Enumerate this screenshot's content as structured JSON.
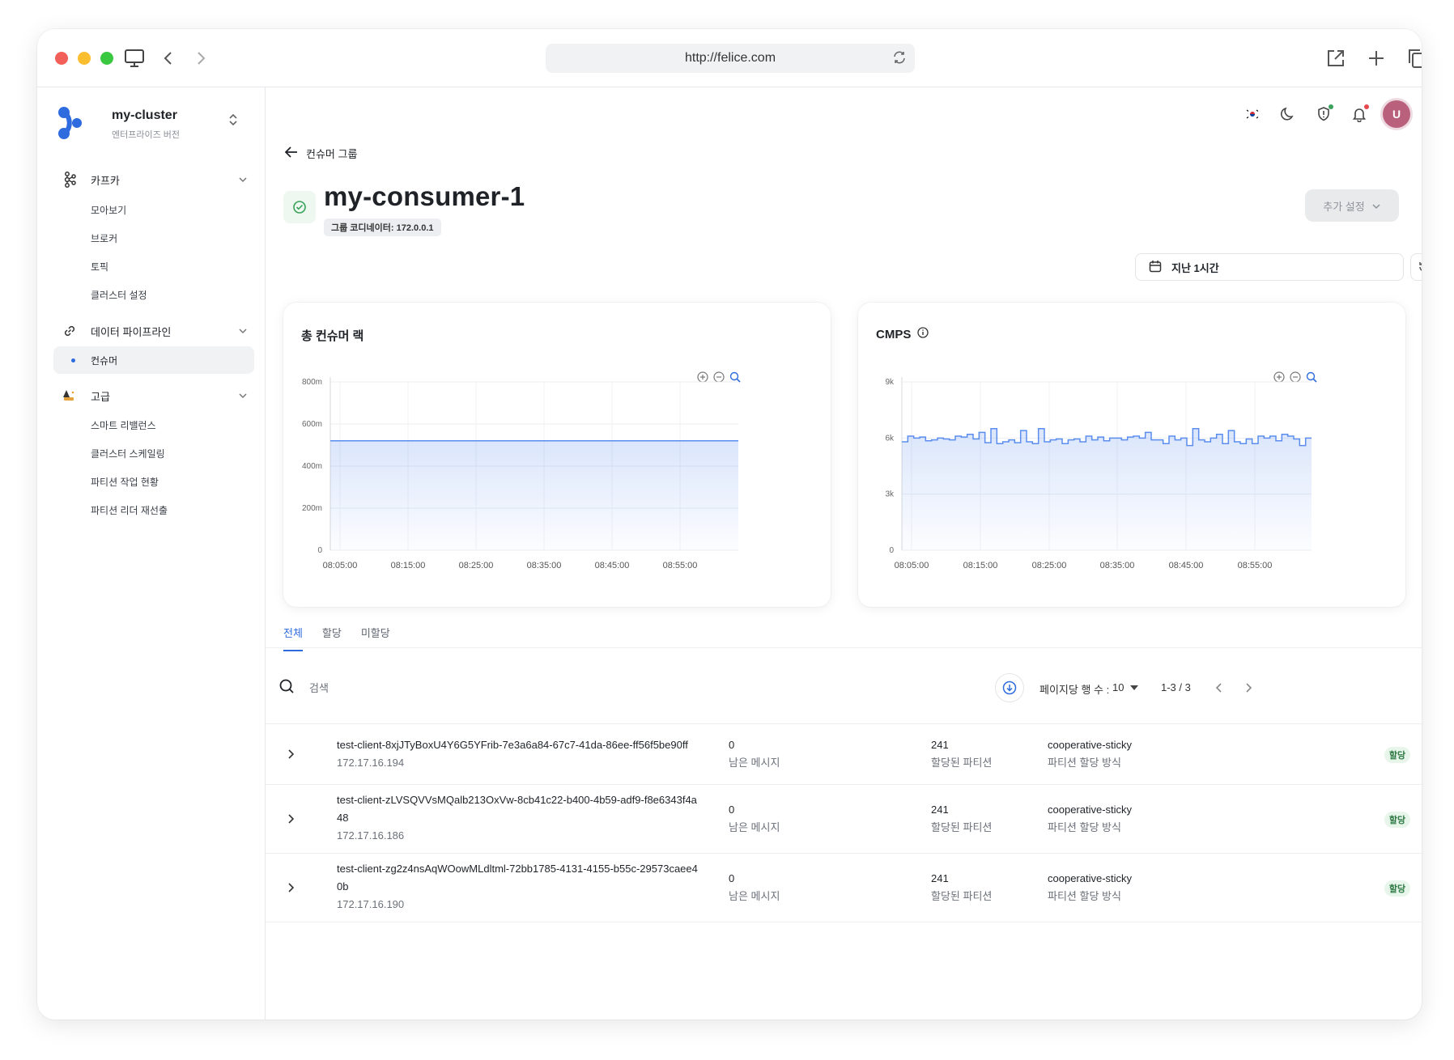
{
  "browser": {
    "url": "http://felice.com"
  },
  "sidebar": {
    "cluster_name": "my-cluster",
    "cluster_edition": "엔터프라이즈 버전",
    "groups": [
      {
        "label": "카프카",
        "items": [
          "모아보기",
          "브로커",
          "토픽",
          "클러스터 설정"
        ]
      },
      {
        "label": "데이터 파이프라인",
        "items": [
          "컨슈머"
        ]
      },
      {
        "label": "고급",
        "items": [
          "스마트 리밸런스",
          "클러스터 스케일링",
          "파티션 작업 현황",
          "파티션 리더 재선출"
        ]
      }
    ],
    "active_item": "컨슈머"
  },
  "header": {
    "avatar_initial": "U",
    "back_label": "컨슈머 그룹",
    "title": "my-consumer-1",
    "coordinator": "그룹 코디네이터: 172.0.0.1",
    "more_label": "추가 설정",
    "time_range": "지난 1시간"
  },
  "charts": {
    "lag_title": "총 컨슈머 랙",
    "cmps_title": "CMPS"
  },
  "chart_data": [
    {
      "type": "area",
      "title": "총 컨슈머 랙",
      "x": [
        "08:05:00",
        "08:15:00",
        "08:25:00",
        "08:35:00",
        "08:45:00",
        "08:55:00"
      ],
      "y_ticks": [
        "0",
        "200m",
        "400m",
        "600m",
        "800m"
      ],
      "ylim": [
        0,
        800
      ],
      "values": [
        520,
        520,
        520,
        520,
        520,
        520
      ],
      "grid": true,
      "color": "#5b8def"
    },
    {
      "type": "area",
      "title": "CMPS",
      "x": [
        "08:05:00",
        "08:15:00",
        "08:25:00",
        "08:35:00",
        "08:45:00",
        "08:55:00"
      ],
      "y_ticks": [
        "0",
        "3k",
        "6k",
        "9k"
      ],
      "ylim": [
        0,
        9000
      ],
      "values": [
        5800,
        6100,
        6000,
        6050,
        5850,
        5900,
        6000,
        5950,
        5900,
        6100,
        6050,
        6200,
        5950,
        6300,
        5750,
        6500,
        5700,
        5800,
        5900,
        5750,
        6400,
        5800,
        5700,
        6500,
        5800,
        5900,
        5950,
        5700,
        5900,
        5950,
        5800,
        6100,
        5900,
        6050,
        5850,
        6000,
        6000,
        5900,
        6050,
        6100,
        6000,
        6300,
        5900,
        5900,
        5700,
        6100,
        5900,
        6000,
        5600,
        6500,
        5900,
        5800,
        6000,
        6200,
        5700,
        6400,
        5800,
        5700,
        5950,
        5700,
        6100,
        6000,
        6100,
        5850,
        6200,
        6100,
        5950,
        5600,
        6000
      ],
      "grid": true,
      "color": "#5b8def"
    }
  ],
  "tabs": [
    "전체",
    "할당",
    "미할당"
  ],
  "toolbar": {
    "search_placeholder": "검색",
    "rows_label": "페이지당 행 수 :",
    "rows_value": "10",
    "page_range": "1-3 / 3"
  },
  "rows": [
    {
      "client_id": "test-client-8xjJTyBoxU4Y6G5YFrib-7e3a6a84-67c7-41da-86ee-ff56f5be90ff",
      "ip": "172.17.16.194",
      "remaining": "0",
      "remaining_label": "남은 메시지",
      "partitions": "241",
      "partitions_label": "할당된 파티션",
      "strategy": "cooperative-sticky",
      "strategy_label": "파티션 할당 방식",
      "status": "할당"
    },
    {
      "client_id": "test-client-zLVSQVVsMQalb213OxVw-8cb41c22-b400-4b59-adf9-f8e6343f4a48",
      "ip": "172.17.16.186",
      "remaining": "0",
      "remaining_label": "남은 메시지",
      "partitions": "241",
      "partitions_label": "할당된 파티션",
      "strategy": "cooperative-sticky",
      "strategy_label": "파티션 할당 방식",
      "status": "할당"
    },
    {
      "client_id": "test-client-zg2z4nsAqWOowMLdltml-72bb1785-4131-4155-b55c-29573caee40b",
      "ip": "172.17.16.190",
      "remaining": "0",
      "remaining_label": "남은 메시지",
      "partitions": "241",
      "partitions_label": "할당된 파티션",
      "strategy": "cooperative-sticky",
      "strategy_label": "파티션 할당 방식",
      "status": "할당"
    }
  ],
  "colors": {
    "accent": "#2e6bdf",
    "success": "#3aa25a",
    "avatar": "#b9607d"
  }
}
